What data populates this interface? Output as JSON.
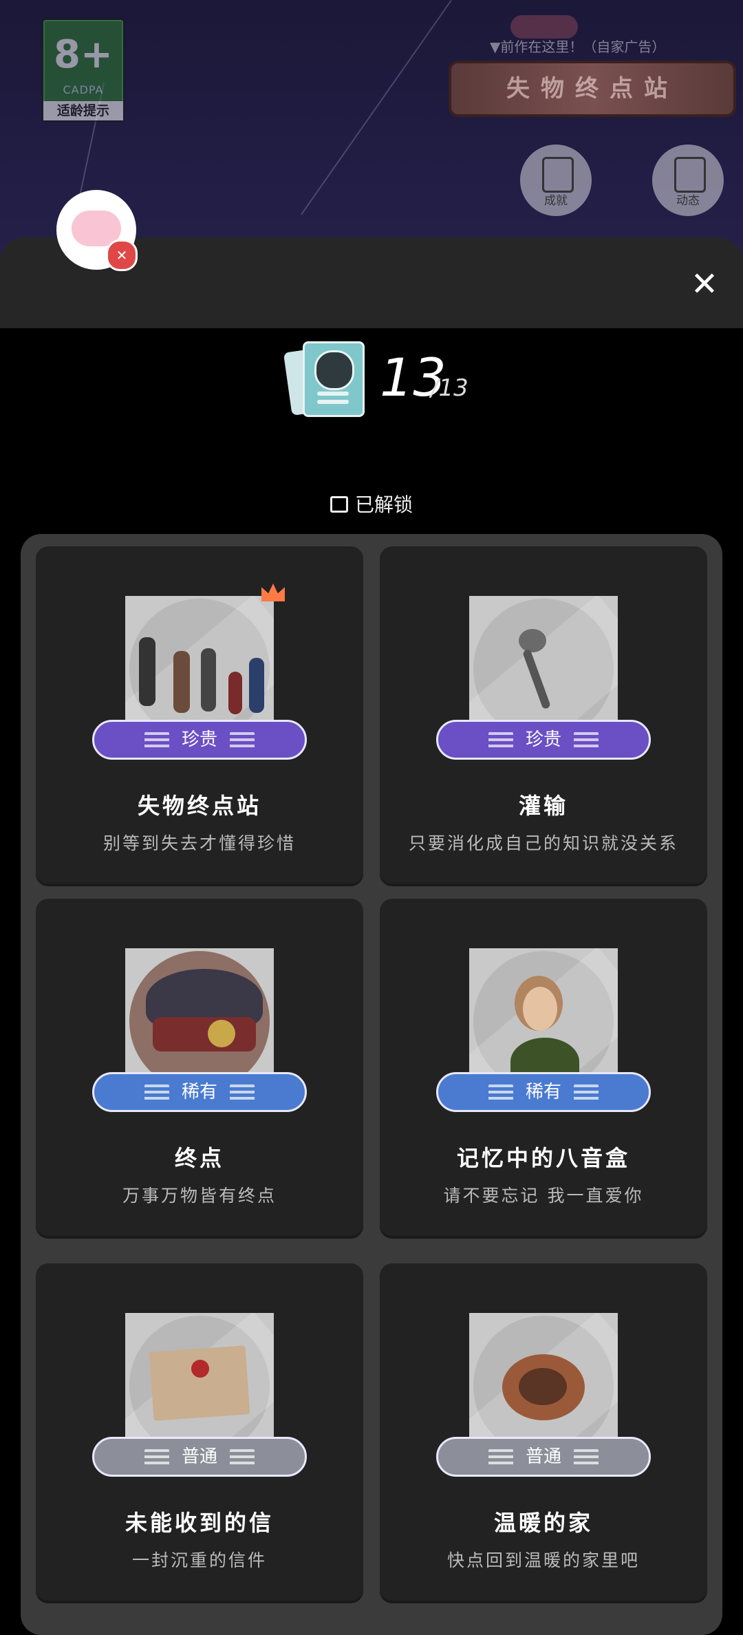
{
  "background": {
    "age_badge": {
      "rating": "8+",
      "org": "CADPA",
      "tip": "适龄提示"
    },
    "ad_hint": "▼前作在这里！（自家广告）",
    "ad_banner": "失物终点站",
    "buttons": [
      {
        "label": "成就",
        "icon": "achievement-icon"
      },
      {
        "label": "动态",
        "icon": "feed-icon"
      }
    ]
  },
  "header": {
    "close_icon": "close-icon",
    "count": "13",
    "total": "/13",
    "unlocked_label": "已解锁"
  },
  "items": [
    {
      "title": "失物终点站",
      "desc": "别等到失去才懂得珍惜",
      "rarity": "珍贵",
      "rarity_level": "precious",
      "is_new": true
    },
    {
      "title": "灌输",
      "desc": "只要消化成自己的知识就没关系",
      "rarity": "珍贵",
      "rarity_level": "precious",
      "is_new": false
    },
    {
      "title": "终点",
      "desc": "万事万物皆有终点",
      "rarity": "稀有",
      "rarity_level": "rare",
      "is_new": false
    },
    {
      "title": "记忆中的八音盒",
      "desc": "请不要忘记 我一直爱你",
      "rarity": "稀有",
      "rarity_level": "rare",
      "is_new": false
    },
    {
      "title": "未能收到的信",
      "desc": "一封沉重的信件",
      "rarity": "普通",
      "rarity_level": "common",
      "is_new": false
    },
    {
      "title": "温暖的家",
      "desc": "快点回到温暖的家里吧",
      "rarity": "普通",
      "rarity_level": "common",
      "is_new": false
    }
  ],
  "colors": {
    "precious": "#6a4fc5",
    "rare": "#4a7bd0",
    "common": "#8c8f99",
    "new_badge": "#ff7a45"
  }
}
